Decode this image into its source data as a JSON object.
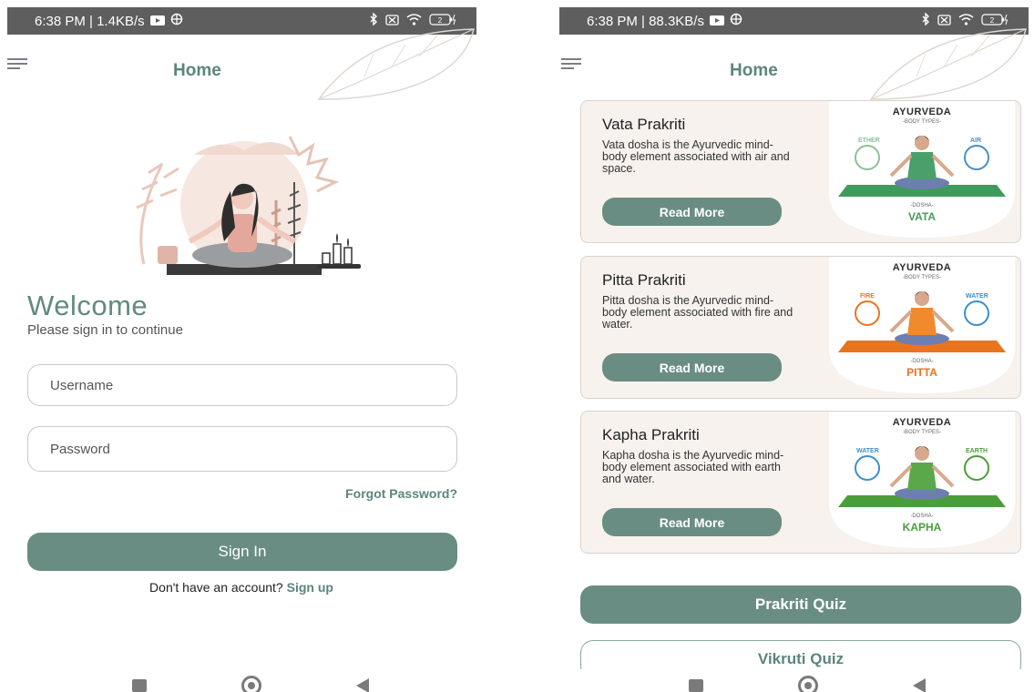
{
  "left": {
    "status": {
      "time_speed": "6:38 PM | 1.4KB/s",
      "battery": "2"
    },
    "title": "Home",
    "welcome": "Welcome",
    "subtitle": "Please sign in to continue",
    "username_placeholder": "Username",
    "password_placeholder": "Password",
    "forgot": "Forgot Password?",
    "signin": "Sign In",
    "no_account": "Don't have an account?",
    "signup": "Sign up"
  },
  "right": {
    "status": {
      "time_speed": "6:38 PM | 88.3KB/s",
      "battery": "2"
    },
    "title": "Home",
    "cards": [
      {
        "title": "Vata Prakriti",
        "description": "Vata dosha is the Ayurvedic mind-body element associated with air and space.",
        "button": "Read More",
        "art": {
          "heading": "AYURVEDA",
          "sub": "-BODY TYPES-",
          "left": "ETHER",
          "right": "AIR",
          "dosha": "-DOSHA-",
          "name": "VATA",
          "shirt": "#4aa06a",
          "mat": "#3f9b5a",
          "left_color": "#8fbf9a",
          "right_color": "#4a8fc5",
          "name_color": "#4a9a5a"
        }
      },
      {
        "title": "Pitta Prakriti",
        "description": "Pitta dosha is the Ayurvedic mind-body element associated with fire and water.",
        "button": "Read More",
        "art": {
          "heading": "AYURVEDA",
          "sub": "-BODY TYPES-",
          "left": "FIRE",
          "right": "WATER",
          "dosha": "-DOSHA-",
          "name": "PITTA",
          "shirt": "#f08a2c",
          "mat": "#e8741e",
          "left_color": "#e8741e",
          "right_color": "#3a8fd0",
          "name_color": "#e8741e"
        }
      },
      {
        "title": "Kapha Prakriti",
        "description": "Kapha dosha is the Ayurvedic mind-body element associated with earth and water.",
        "button": "Read More",
        "art": {
          "heading": "AYURVEDA",
          "sub": "-BODY TYPES-",
          "left": "WATER",
          "right": "EARTH",
          "dosha": "-DOSHA-",
          "name": "KAPHA",
          "shirt": "#5aa84a",
          "mat": "#4a9e3a",
          "left_color": "#3a8fd0",
          "right_color": "#4a9e3a",
          "name_color": "#4a9e3a"
        }
      }
    ],
    "prakriti_quiz": "Prakriti Quiz",
    "vikruti_quiz": "Vikruti Quiz"
  },
  "colors": {
    "accent": "#6a8d83",
    "title": "#5b857c",
    "card_bg": "#f7f2ee"
  }
}
